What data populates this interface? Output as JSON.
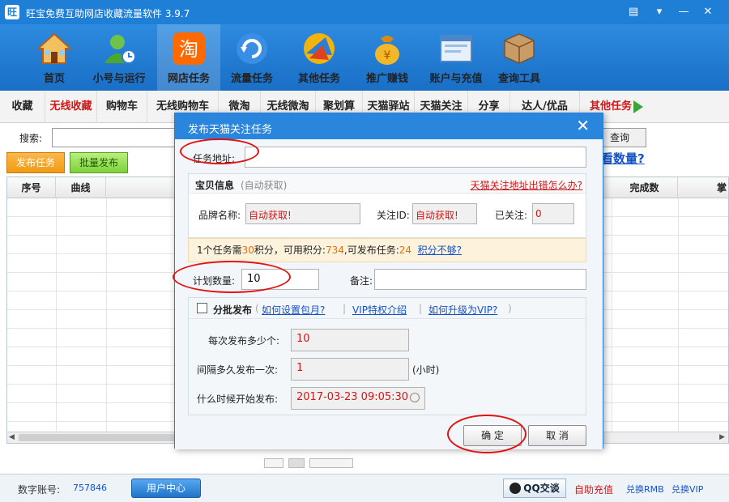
{
  "app": {
    "title": "旺宝免费互助网店收藏流量软件 3.9.7"
  },
  "toolbar": [
    {
      "label": "首页",
      "icon": "home-icon",
      "color": "#e8a040"
    },
    {
      "label": "小号与运行",
      "icon": "user-run-icon",
      "color": "#5aaa3c"
    },
    {
      "label": "网店任务",
      "icon": "taobao-icon",
      "color": "#ff6a00"
    },
    {
      "label": "流量任务",
      "icon": "refresh-icon",
      "color": "#3a8ee6"
    },
    {
      "label": "其他任务",
      "icon": "ball-icon",
      "color": "#f2b30c"
    },
    {
      "label": "推广赚钱",
      "icon": "moneybag-icon",
      "color": "#e89a10"
    },
    {
      "label": "账户与充值",
      "icon": "window-icon",
      "color": "#6aa0d8"
    },
    {
      "label": "查询工具",
      "icon": "box-icon",
      "color": "#b08050"
    }
  ],
  "tabs": [
    "收藏",
    "无线收藏",
    "购物车",
    "无线购物车",
    "微淘",
    "无线微淘",
    "聚划算",
    "天猫驿站",
    "天猫关注",
    "分享",
    "达人/优品",
    "其他任务"
  ],
  "search": {
    "label": "搜索:",
    "query": "查询",
    "see_count": "看数量?"
  },
  "actions": {
    "publish": "发布任务",
    "batch": "批量发布"
  },
  "table": {
    "headers": [
      "序号",
      "曲线",
      "完成数",
      "掌"
    ]
  },
  "status": {
    "account_label": "数字账号:",
    "account_value": "757846",
    "user_center": "用户中心",
    "qq": "QQ交谈",
    "auto_recharge": "自助充值",
    "rmb": "兑换RMB",
    "vip": "兑换VIP"
  },
  "dialog": {
    "title": "发布天猫关注任务",
    "close": "✕",
    "task_url_label": "任务地址:",
    "task_url_value": "",
    "goods_title": "宝贝信息",
    "goods_auto": "(自动获取)",
    "goods_help": "天猫关注地址出错怎么办?",
    "brand_label": "品牌名称:",
    "brand_value": "自动获取!",
    "follow_id_label": "关注ID:",
    "follow_id_value": "自动获取!",
    "followed_label": "已关注:",
    "followed_value": "0",
    "points": {
      "p1": "1个任务需",
      "n1": "30",
      "p2": "积分，可用积分:",
      "n2": "734",
      "p3": ",可发布任务:",
      "n3": "24",
      "link": "积分不够?"
    },
    "plan_label": "计划数量:",
    "plan_value": "10",
    "note_label": "备注:",
    "note_value": "",
    "batch_title": "分批发布",
    "batch_link1": "如何设置包月?",
    "batch_link2": "VIP特权介绍",
    "batch_link3": "如何升级为VIP?",
    "per_label": "每次发布多少个:",
    "per_value": "10",
    "interval_label": "间隔多久发布一次:",
    "interval_value": "1",
    "interval_unit": "(小时)",
    "start_label": "什么时候开始发布:",
    "start_value": "2017-03-23 09:05:30",
    "ok": "确 定",
    "cancel": "取 消"
  }
}
